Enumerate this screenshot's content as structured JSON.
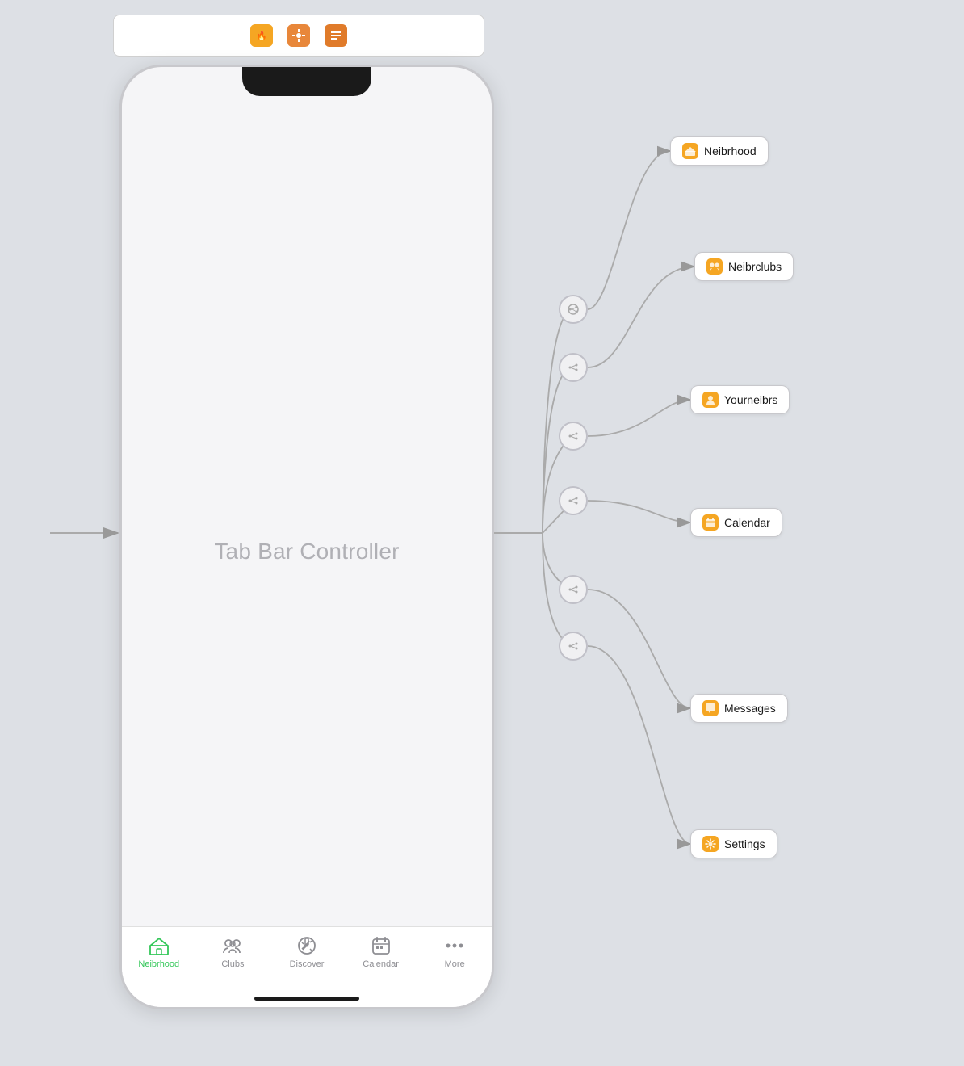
{
  "toolbar": {
    "icons": [
      "🔥",
      "⚙️",
      "📋"
    ]
  },
  "phone": {
    "title": "Tab Bar Controller"
  },
  "tabs": [
    {
      "id": "neibrhood",
      "label": "Neibrhood",
      "active": true
    },
    {
      "id": "clubs",
      "label": "Clubs",
      "active": false
    },
    {
      "id": "discover",
      "label": "Discover",
      "active": false
    },
    {
      "id": "calendar",
      "label": "Calendar",
      "active": false
    },
    {
      "id": "more",
      "label": "More",
      "active": false
    }
  ],
  "destinations": [
    {
      "id": "neibrhood",
      "label": "Neibrhood"
    },
    {
      "id": "neibrclubs",
      "label": "Neibrclubs"
    },
    {
      "id": "yourneibrs",
      "label": "Yourneibrs"
    },
    {
      "id": "calendar",
      "label": "Calendar"
    },
    {
      "id": "messages",
      "label": "Messages"
    },
    {
      "id": "settings",
      "label": "Settings"
    }
  ]
}
